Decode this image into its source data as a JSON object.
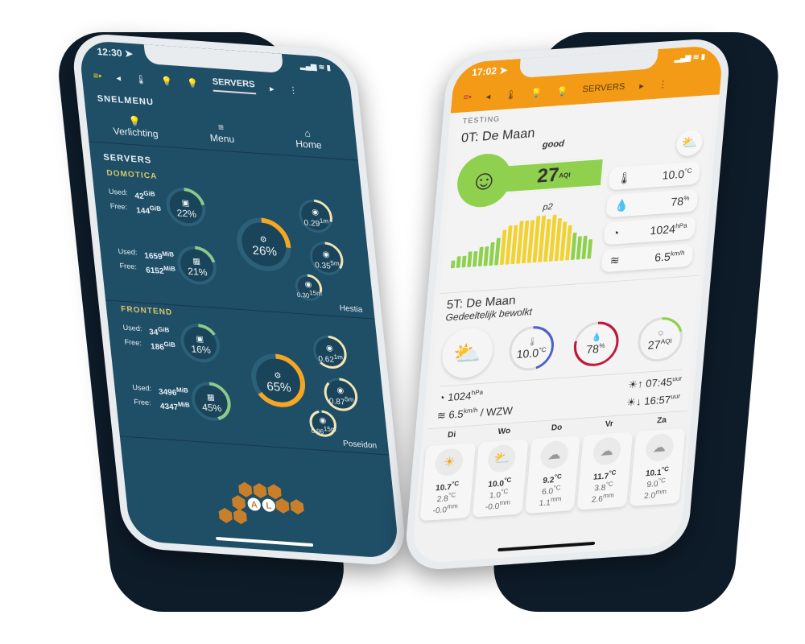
{
  "left": {
    "status": {
      "time": "12:30 ➤",
      "icons": "▂▄▆ ≋ ▮"
    },
    "tabs": [
      {
        "label": "◂"
      },
      {
        "label": "🌡"
      },
      {
        "label": "💡"
      },
      {
        "label": "💡"
      },
      {
        "label": "SERVERS"
      },
      {
        "label": "▸"
      },
      {
        "label": "⋮"
      }
    ],
    "snelmenu": "SNELMENU",
    "quick": [
      {
        "icon": "💡",
        "label": "Verlichting"
      },
      {
        "icon": "≡",
        "label": "Menu"
      },
      {
        "icon": "⌂",
        "label": "Home"
      }
    ],
    "servers_title": "SERVERS",
    "groups": [
      {
        "name": "DOMOTICA",
        "host": "Hestia",
        "disk": {
          "used_label": "Used:",
          "used": "42",
          "free_label": "Free:",
          "free": "144",
          "unit": "GiB",
          "pct": 22
        },
        "mem": {
          "used_label": "Used:",
          "used": "1659",
          "free_label": "Free:",
          "free": "6152",
          "unit": "MiB",
          "pct": 21
        },
        "cpu": {
          "pct": 26
        },
        "load": [
          {
            "value": "0.29",
            "unit": "1m",
            "pct": 30
          },
          {
            "value": "0.35",
            "unit": "5m",
            "pct": 35
          },
          {
            "value": "0.30",
            "unit": "15m",
            "pct": 30
          }
        ]
      },
      {
        "name": "FRONTEND",
        "host": "Poseidon",
        "disk": {
          "used_label": "Used:",
          "used": "34",
          "free_label": "Free:",
          "free": "186",
          "unit": "GiB",
          "pct": 16
        },
        "mem": {
          "used_label": "Used:",
          "used": "3496",
          "free_label": "Free:",
          "free": "4347",
          "unit": "MiB",
          "pct": 45
        },
        "cpu": {
          "pct": 65
        },
        "load": [
          {
            "value": "0.62",
            "unit": "1m",
            "pct": 62
          },
          {
            "value": "0.87",
            "unit": "5m",
            "pct": 87
          },
          {
            "value": "0.96",
            "unit": "15m",
            "pct": 96
          }
        ]
      }
    ],
    "logo_text": "AL"
  },
  "right": {
    "status": {
      "time": "17:02 ➤",
      "icons": "▂▄▆ ≋ ▮"
    },
    "tabs": [
      {
        "label": "◂"
      },
      {
        "label": "🌡"
      },
      {
        "label": "💡"
      },
      {
        "label": "💡"
      },
      {
        "label": "SERVERS"
      },
      {
        "label": "▸"
      },
      {
        "label": "⋮"
      }
    ],
    "section": "TESTING",
    "now": {
      "title": "0T: De Maan",
      "quality": "good",
      "aqi": "27",
      "aqi_unit": "AQI",
      "pollutant": "p2",
      "aqi_history": [
        2,
        3,
        3,
        4,
        4,
        5,
        5,
        6,
        7,
        9,
        10,
        10,
        11,
        11,
        11,
        12,
        12,
        11,
        12,
        11,
        10,
        9,
        7,
        6,
        6,
        5
      ],
      "temp": "10.0",
      "temp_unit": "°C",
      "hum": "78",
      "hum_unit": "%",
      "press": "1024",
      "press_unit": "hPa",
      "wind": "6.5",
      "wind_unit": "km/h"
    },
    "forecast_now": {
      "title": "5T: De Maan",
      "desc": "Gedeeltelijk bewolkt",
      "temp": "10.0",
      "temp_unit": "°C",
      "hum": "78",
      "hum_unit": "%",
      "aqi": "27",
      "aqi_unit": "AQI",
      "press": "1024",
      "press_unit": "hPa",
      "wind": "6.5",
      "wind_unit": "km/h",
      "wind_dir": "/ WZW",
      "sunrise": "07:45",
      "sunset": "16:57",
      "time_unit": "uur"
    },
    "days": [
      {
        "day": "Di",
        "icon": "☀",
        "max": "10.7",
        "min": "2.8",
        "rain": "-0.0"
      },
      {
        "day": "Wo",
        "icon": "⛅",
        "max": "10.0",
        "min": "1.0",
        "rain": "-0.0"
      },
      {
        "day": "Do",
        "icon": "☁",
        "max": "9.2",
        "min": "6.0",
        "rain": "1.1"
      },
      {
        "day": "Vr",
        "icon": "☁",
        "max": "11.7",
        "min": "3.8",
        "rain": "2.6"
      },
      {
        "day": "Za",
        "icon": "☁",
        "max": "10.1",
        "min": "9.0",
        "rain": "2.0"
      }
    ],
    "units": {
      "temp": "°C",
      "rain": "mm"
    }
  },
  "colors": {
    "left_bg": "#1f4e67",
    "accent_orange": "#f5a623",
    "gauge_green": "#8fc98a",
    "header_orange": "#f39b16",
    "aqi_green": "#8fd14f",
    "aqi_yellow": "#f2d22e"
  }
}
